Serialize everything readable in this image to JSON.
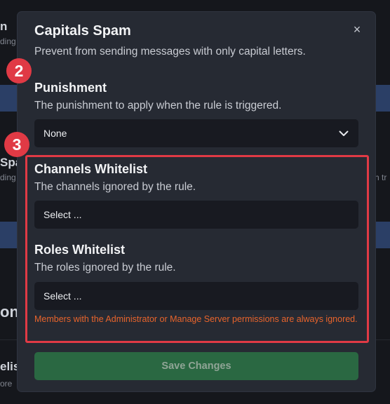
{
  "background": {
    "fragments": [
      "n",
      "ding",
      "Spa",
      "ding",
      "h tr",
      "on",
      "elis",
      "ore"
    ]
  },
  "modal": {
    "title": "Capitals Spam",
    "description": "Prevent from sending messages with only capital letters.",
    "close_icon": "×"
  },
  "punishment": {
    "title": "Punishment",
    "description": "The punishment to apply when the rule is triggered.",
    "value": "None"
  },
  "channels_whitelist": {
    "title": "Channels Whitelist",
    "description": "The channels ignored by the rule.",
    "placeholder": "Select ..."
  },
  "roles_whitelist": {
    "title": "Roles Whitelist",
    "description": "The roles ignored by the rule.",
    "placeholder": "Select ...",
    "note": "Members with the Administrator or Manage Server permissions are always ignored."
  },
  "save_button": "Save Changes",
  "badges": {
    "step2": "2",
    "step3": "3"
  },
  "colors": {
    "highlight": "#e03a45",
    "save_button": "#2a6842",
    "note": "#e8642c"
  }
}
